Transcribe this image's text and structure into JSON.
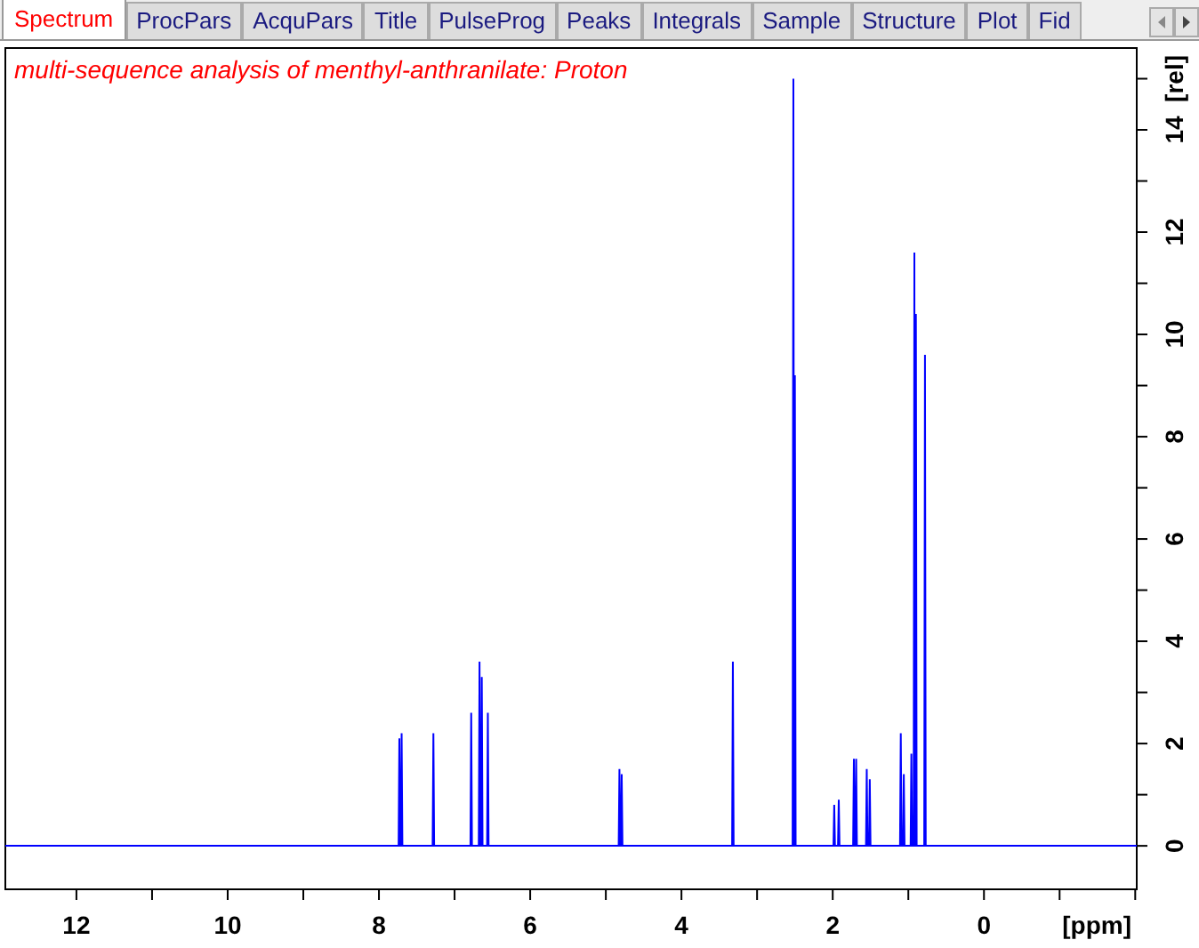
{
  "tabs": [
    {
      "label": "Spectrum",
      "selected": true
    },
    {
      "label": "ProcPars",
      "selected": false
    },
    {
      "label": "AcquPars",
      "selected": false
    },
    {
      "label": "Title",
      "selected": false
    },
    {
      "label": "PulseProg",
      "selected": false
    },
    {
      "label": "Peaks",
      "selected": false
    },
    {
      "label": "Integrals",
      "selected": false
    },
    {
      "label": "Sample",
      "selected": false
    },
    {
      "label": "Structure",
      "selected": false
    },
    {
      "label": "Plot",
      "selected": false
    },
    {
      "label": "Fid",
      "selected": false
    }
  ],
  "spectrum": {
    "chart_data": {
      "type": "line",
      "title": "multi-sequence analysis of menthyl-anthranilate: Proton",
      "xlabel": "[ppm]",
      "ylabel": "[rel]",
      "xlim": [
        12.94,
        -2.02
      ],
      "ylim": [
        -0.85,
        15.6
      ],
      "xticks": [
        12,
        10,
        8,
        6,
        4,
        2,
        0
      ],
      "yticks": [
        0,
        2,
        4,
        6,
        8,
        10,
        12,
        14
      ],
      "x": [
        12.94,
        7.74,
        7.73,
        7.72,
        7.71,
        7.7,
        7.69,
        7.29,
        7.28,
        7.27,
        6.79,
        6.78,
        6.77,
        6.68,
        6.67,
        6.66,
        6.65,
        6.64,
        6.63,
        6.57,
        6.56,
        6.55,
        4.83,
        4.82,
        4.81,
        4.8,
        4.79,
        4.78,
        3.33,
        3.32,
        3.31,
        2.53,
        2.52,
        2.51,
        2.505,
        2.5,
        2.49,
        1.99,
        1.98,
        1.97,
        1.93,
        1.92,
        1.91,
        1.73,
        1.72,
        1.71,
        1.7,
        1.69,
        1.68,
        1.56,
        1.55,
        1.54,
        1.52,
        1.51,
        1.5,
        1.11,
        1.1,
        1.09,
        1.07,
        1.06,
        1.05,
        0.97,
        0.96,
        0.95,
        0.93,
        0.92,
        0.915,
        0.91,
        0.9,
        0.89,
        0.79,
        0.78,
        0.77,
        -2.02
      ],
      "series": [
        {
          "color": "#0000ff",
          "values": [
            0,
            0,
            2.1,
            0,
            0,
            2.2,
            0,
            0,
            2.2,
            0,
            0,
            2.6,
            0,
            0,
            3.6,
            0,
            0,
            3.3,
            0,
            0,
            2.6,
            0,
            0,
            1.5,
            0,
            0,
            1.4,
            0,
            0,
            3.6,
            0,
            0,
            15,
            0,
            0,
            9.2,
            0,
            0,
            0.8,
            0,
            0,
            0.9,
            0,
            0,
            1.7,
            0,
            0,
            1.7,
            0,
            0,
            1.5,
            0,
            0,
            1.3,
            0,
            0,
            2.2,
            0,
            0,
            1.4,
            0,
            0,
            1.8,
            0,
            0,
            11.6,
            0,
            0,
            10.4,
            0,
            0,
            9.6,
            0,
            0
          ]
        }
      ]
    }
  }
}
